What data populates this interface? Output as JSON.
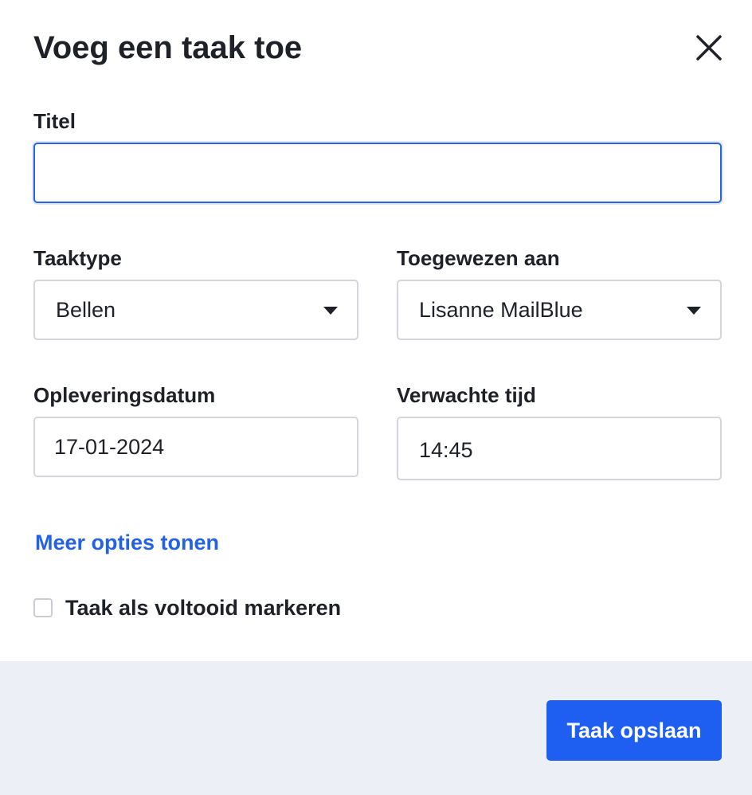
{
  "dialog": {
    "title": "Voeg een taak toe",
    "close_icon": "close-icon"
  },
  "form": {
    "title_label": "Titel",
    "title_value": "",
    "task_type_label": "Taaktype",
    "task_type_value": "Bellen",
    "assigned_label": "Toegewezen aan",
    "assigned_value": "Lisanne MailBlue",
    "due_date_label": "Opleveringsdatum",
    "due_date_value": "17-01-2024",
    "expected_time_label": "Verwachte tijd",
    "expected_time_value": "14:45",
    "more_options_link": "Meer opties tonen",
    "mark_complete_label": "Taak als voltooid markeren",
    "mark_complete_checked": false
  },
  "footer": {
    "save_label": "Taak opslaan"
  },
  "colors": {
    "accent": "#1e5ef0",
    "link": "#2462e4",
    "focus_border": "#2a62e6",
    "footer_bg": "#eceff6",
    "text": "#1f2129",
    "border": "#d3d6dd"
  }
}
